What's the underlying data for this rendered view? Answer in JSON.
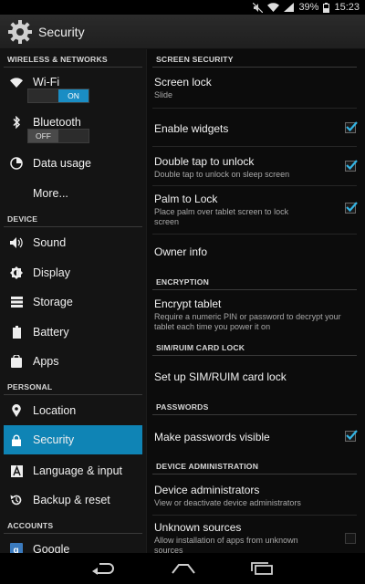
{
  "status_bar": {
    "battery": "39%",
    "time": "15:23"
  },
  "app_bar": {
    "title": "Security",
    "icon": "gear-icon"
  },
  "sidebar": {
    "wireless_header": "WIRELESS & NETWORKS",
    "wifi": {
      "label": "Wi-Fi",
      "toggle": "ON",
      "icon": "wifi-icon"
    },
    "bluetooth": {
      "label": "Bluetooth",
      "toggle": "OFF",
      "icon": "bluetooth-icon"
    },
    "data_usage": {
      "label": "Data usage",
      "icon": "data-usage-icon"
    },
    "more": {
      "label": "More..."
    },
    "device_header": "DEVICE",
    "sound": {
      "label": "Sound",
      "icon": "speaker-icon"
    },
    "display": {
      "label": "Display",
      "icon": "brightness-icon"
    },
    "storage": {
      "label": "Storage",
      "icon": "storage-icon"
    },
    "battery": {
      "label": "Battery",
      "icon": "battery-icon"
    },
    "apps": {
      "label": "Apps",
      "icon": "apps-icon"
    },
    "personal_header": "PERSONAL",
    "location": {
      "label": "Location",
      "icon": "location-pin-icon"
    },
    "security": {
      "label": "Security",
      "icon": "lock-icon"
    },
    "language": {
      "label": "Language & input",
      "icon": "language-icon"
    },
    "backup": {
      "label": "Backup & reset",
      "icon": "backup-icon"
    },
    "accounts_header": "ACCOUNTS",
    "google": {
      "label": "Google",
      "icon": "google-icon"
    }
  },
  "main": {
    "screen_security_header": "SCREEN SECURITY",
    "screen_lock": {
      "title": "Screen lock",
      "summary": "Slide"
    },
    "enable_widgets": {
      "title": "Enable widgets",
      "checked": true
    },
    "double_tap": {
      "title": "Double tap to unlock",
      "summary": "Double tap to unlock on sleep screen",
      "checked": true
    },
    "palm_lock": {
      "title": "Palm to Lock",
      "summary": "Place palm over tablet screen to lock screen",
      "checked": true
    },
    "owner_info": {
      "title": "Owner info"
    },
    "encryption_header": "ENCRYPTION",
    "encrypt_tablet": {
      "title": "Encrypt tablet",
      "summary": "Require a numeric PIN or password to decrypt your tablet each time you power it on"
    },
    "sim_header": "SIM/RUIM CARD LOCK",
    "sim_lock": {
      "title": "Set up SIM/RUIM card lock"
    },
    "passwords_header": "PASSWORDS",
    "make_visible": {
      "title": "Make passwords visible",
      "checked": true
    },
    "device_admin_header": "DEVICE ADMINISTRATION",
    "device_admins": {
      "title": "Device administrators",
      "summary": "View or deactivate device administrators"
    },
    "unknown_sources": {
      "title": "Unknown sources",
      "summary": "Allow installation of apps from unknown sources",
      "checked": false
    }
  },
  "colors": {
    "accent": "#0f84b5",
    "check": "#33b5e5"
  },
  "nav_bar": {
    "back": "back-icon",
    "home": "home-icon",
    "recents": "recent-apps-icon"
  }
}
